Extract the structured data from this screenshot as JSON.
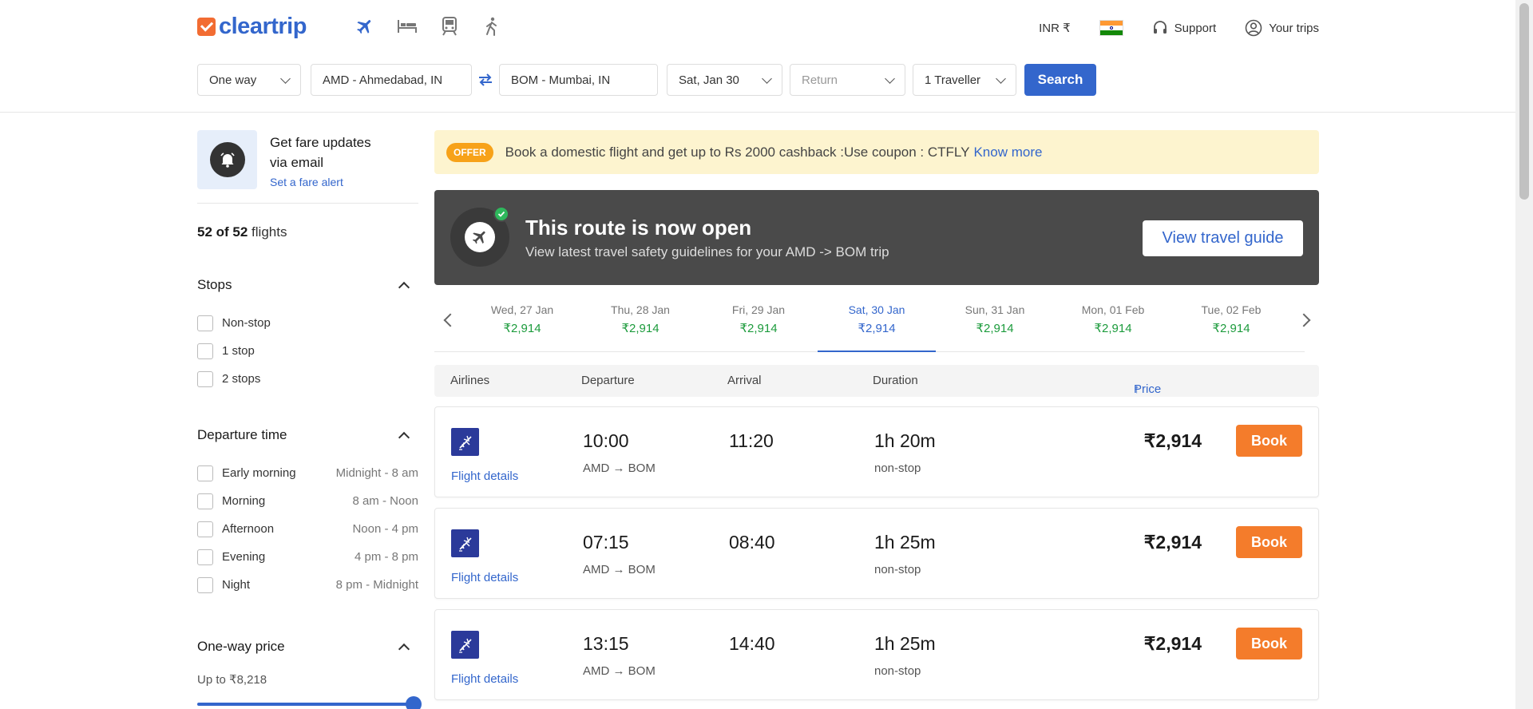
{
  "brand": {
    "name": "cleartrip"
  },
  "header": {
    "nav_icons": [
      "flight-icon",
      "hotel-icon",
      "train-icon",
      "activities-icon"
    ],
    "currency": "INR ₹",
    "support": "Support",
    "your_trips": "Your trips"
  },
  "search": {
    "trip_type": "One way",
    "from": "AMD - Ahmedabad, IN",
    "to": "BOM - Mumbai, IN",
    "depart": "Sat, Jan 30",
    "return_placeholder": "Return",
    "travellers": "1 Traveller",
    "button": "Search"
  },
  "sidebar": {
    "fare_alert": {
      "line1": "Get fare updates",
      "line2": "via email",
      "link": "Set a fare alert"
    },
    "count": {
      "shown": "52 of 52",
      "suffix": "flights"
    },
    "stops": {
      "title": "Stops",
      "items": [
        "Non-stop",
        "1 stop",
        "2 stops"
      ]
    },
    "departure": {
      "title": "Departure time",
      "items": [
        {
          "label": "Early morning",
          "range": "Midnight - 8 am"
        },
        {
          "label": "Morning",
          "range": "8 am - Noon"
        },
        {
          "label": "Afternoon",
          "range": "Noon - 4 pm"
        },
        {
          "label": "Evening",
          "range": "4 pm - 8 pm"
        },
        {
          "label": "Night",
          "range": "8 pm - Midnight"
        }
      ]
    },
    "price": {
      "title": "One-way price",
      "upto": "Up to ₹8,218",
      "slider_level": 1.0
    }
  },
  "offer": {
    "tag": "OFFER",
    "text": "Book a domestic flight and get up to Rs 2000 cashback :Use coupon : CTFLY",
    "link": "Know more"
  },
  "route_banner": {
    "title": "This route is now open",
    "subtitle": "View latest travel safety guidelines for your AMD -> BOM trip",
    "button": "View travel guide"
  },
  "dates": [
    {
      "day": "Wed, 27 Jan",
      "price": "₹2,914",
      "active": false
    },
    {
      "day": "Thu, 28 Jan",
      "price": "₹2,914",
      "active": false
    },
    {
      "day": "Fri, 29 Jan",
      "price": "₹2,914",
      "active": false
    },
    {
      "day": "Sat, 30 Jan",
      "price": "₹2,914",
      "active": true
    },
    {
      "day": "Sun, 31 Jan",
      "price": "₹2,914",
      "active": false
    },
    {
      "day": "Mon, 01 Feb",
      "price": "₹2,914",
      "active": false
    },
    {
      "day": "Tue, 02 Feb",
      "price": "₹2,914",
      "active": false
    }
  ],
  "table_head": {
    "airlines": "Airlines",
    "departure": "Departure",
    "arrival": "Arrival",
    "duration": "Duration",
    "price": "Price"
  },
  "flights": [
    {
      "dep": "10:00",
      "route": "AMD → BOM",
      "arr": "11:20",
      "dur": "1h 20m",
      "stops": "non-stop",
      "price": "₹2,914",
      "details": "Flight details",
      "book": "Book"
    },
    {
      "dep": "07:15",
      "route": "AMD → BOM",
      "arr": "08:40",
      "dur": "1h 25m",
      "stops": "non-stop",
      "price": "₹2,914",
      "details": "Flight details",
      "book": "Book"
    },
    {
      "dep": "13:15",
      "route": "AMD → BOM",
      "arr": "14:40",
      "dur": "1h 25m",
      "stops": "non-stop",
      "price": "₹2,914",
      "details": "Flight details",
      "book": "Book"
    }
  ],
  "colors": {
    "brand_blue": "#3366cc",
    "brand_orange": "#f26c32",
    "book_orange": "#f47c2b",
    "price_green": "#1c9b3c",
    "offer_bg": "#fdf4cf",
    "banner_bg": "#4a4a4a"
  }
}
